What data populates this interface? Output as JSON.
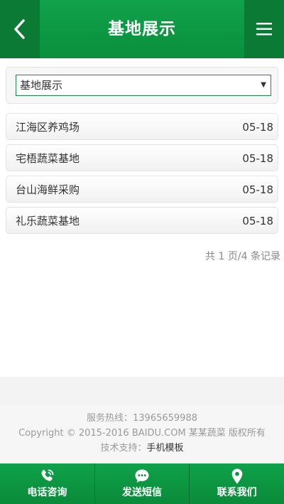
{
  "header": {
    "title": "基地展示",
    "back_icon": "chevron-left-icon",
    "menu_icon": "menu-icon"
  },
  "category_select": {
    "value": "基地展示"
  },
  "list": [
    {
      "title": "江海区养鸡场",
      "date": "05-18"
    },
    {
      "title": "宅梧蔬菜基地",
      "date": "05-18"
    },
    {
      "title": "台山海鲜采购",
      "date": "05-18"
    },
    {
      "title": "礼乐蔬菜基地",
      "date": "05-18"
    }
  ],
  "pager": {
    "text": "共 1 页/4 条记录"
  },
  "footer": {
    "hotline": "服务热线：13965659988",
    "copyright": "Copyright © 2015-2016 BAIDU.COM 某某蔬菜 版权所有",
    "support_prefix": "技术支持：",
    "support_link": "手机模板"
  },
  "bottom_nav": [
    {
      "label": "电话咨询",
      "icon": "phone-icon"
    },
    {
      "label": "发送短信",
      "icon": "chat-icon"
    },
    {
      "label": "联系我们",
      "icon": "location-icon"
    }
  ],
  "colors": {
    "brand_green": "#0a8f3c",
    "dark_green": "#0b7a34"
  }
}
